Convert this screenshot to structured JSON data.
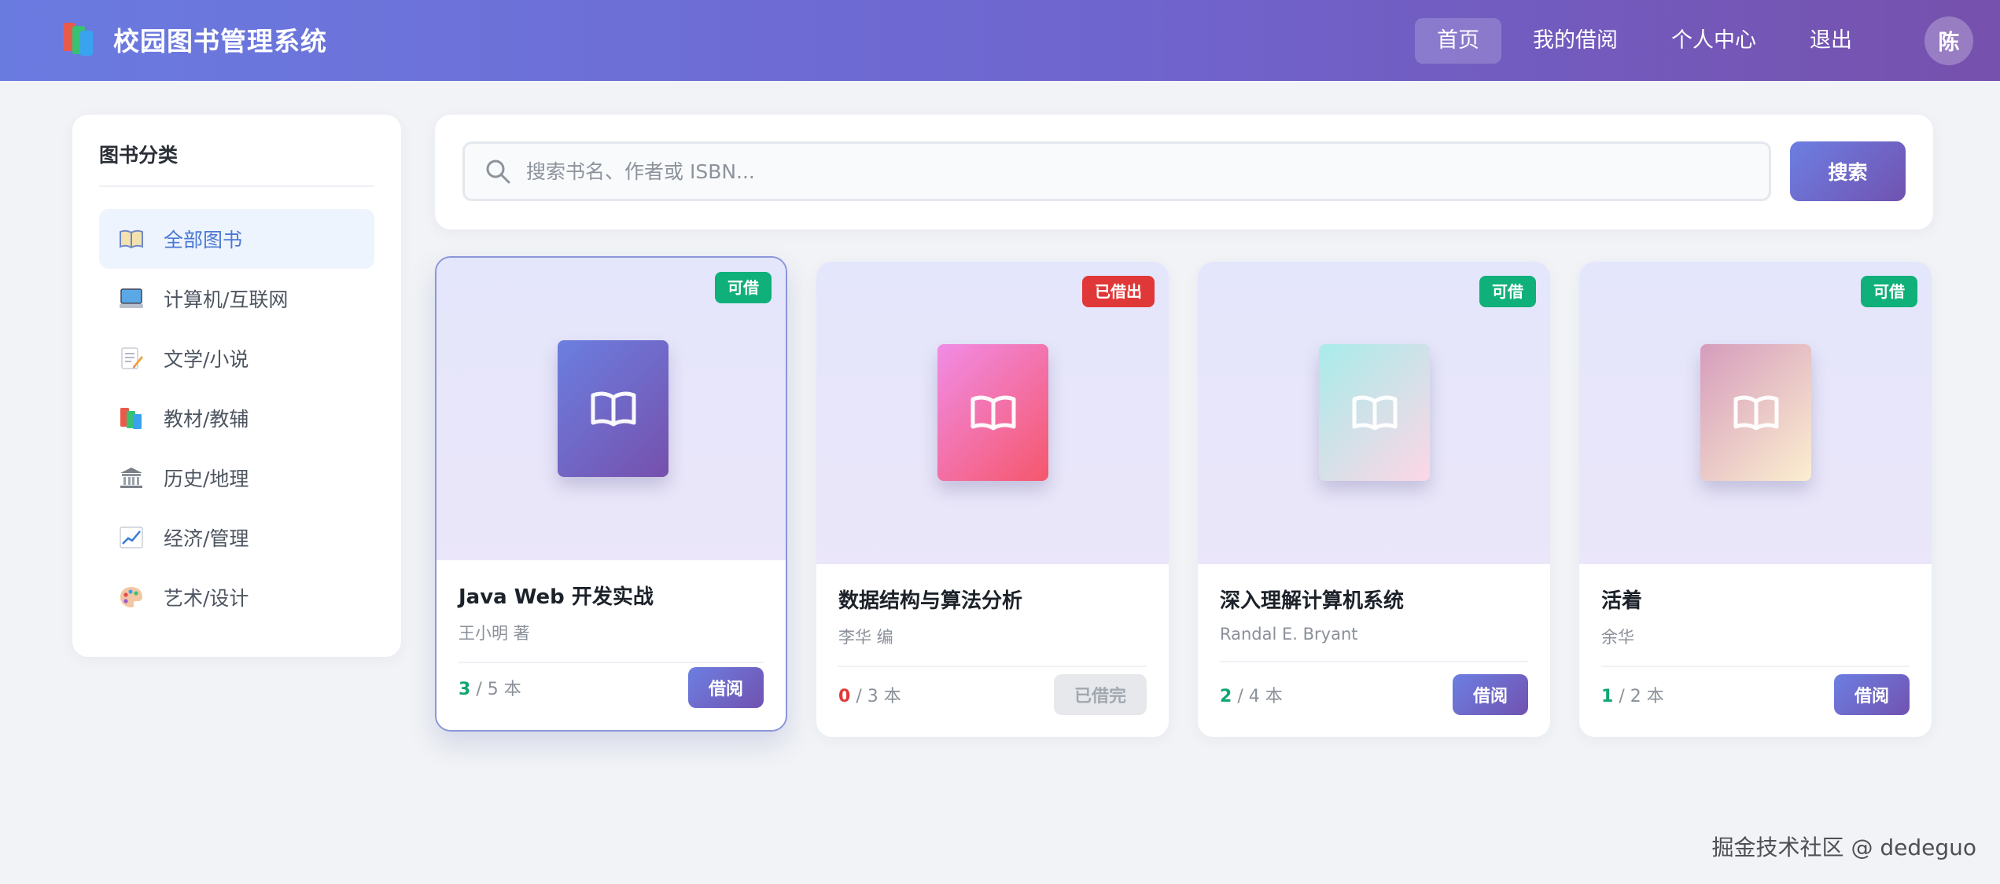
{
  "header": {
    "title": "校园图书管理系统",
    "nav": [
      "首页",
      "我的借阅",
      "个人中心",
      "退出"
    ],
    "avatar": "陈"
  },
  "sidebar": {
    "title": "图书分类",
    "items": [
      {
        "label": "全部图书",
        "icon": "open-book-icon"
      },
      {
        "label": "计算机/互联网",
        "icon": "computer-icon"
      },
      {
        "label": "文学/小说",
        "icon": "memo-icon"
      },
      {
        "label": "教材/教辅",
        "icon": "books-icon"
      },
      {
        "label": "历史/地理",
        "icon": "classical-building-icon"
      },
      {
        "label": "经济/管理",
        "icon": "chart-increasing-icon"
      },
      {
        "label": "艺术/设计",
        "icon": "palette-icon"
      }
    ]
  },
  "search": {
    "placeholder": "搜索书名、作者或 ISBN...",
    "button": "搜索"
  },
  "books": [
    {
      "title": "Java Web 开发实战",
      "author": "王小明 著",
      "status": "可借",
      "available": "3",
      "total": "/ 5 本",
      "action": "借阅",
      "cover": [
        "#6b7fe0",
        "#7650ad"
      ],
      "iconColor": "#ffffff"
    },
    {
      "title": "数据结构与算法分析",
      "author": "李华 编",
      "status": "已借出",
      "available": "0",
      "total": "/ 3 本",
      "action": "已借完",
      "cover": [
        "#f18ce6",
        "#f5576c"
      ],
      "iconColor": "#ffffff"
    },
    {
      "title": "深入理解计算机系统",
      "author": "Randal E. Bryant",
      "status": "可借",
      "available": "2",
      "total": "/ 4 本",
      "action": "借阅",
      "cover": [
        "#a8ecea",
        "#fdd6e6"
      ],
      "iconColor": "#ffffff"
    },
    {
      "title": "活着",
      "author": "余华",
      "status": "可借",
      "available": "1",
      "total": "/ 2 本",
      "action": "借阅",
      "cover": [
        "#d59cbc",
        "#fcefd0"
      ],
      "iconColor": "#ffffff"
    }
  ],
  "watermark": "掘金技术社区 @ dedeguo"
}
